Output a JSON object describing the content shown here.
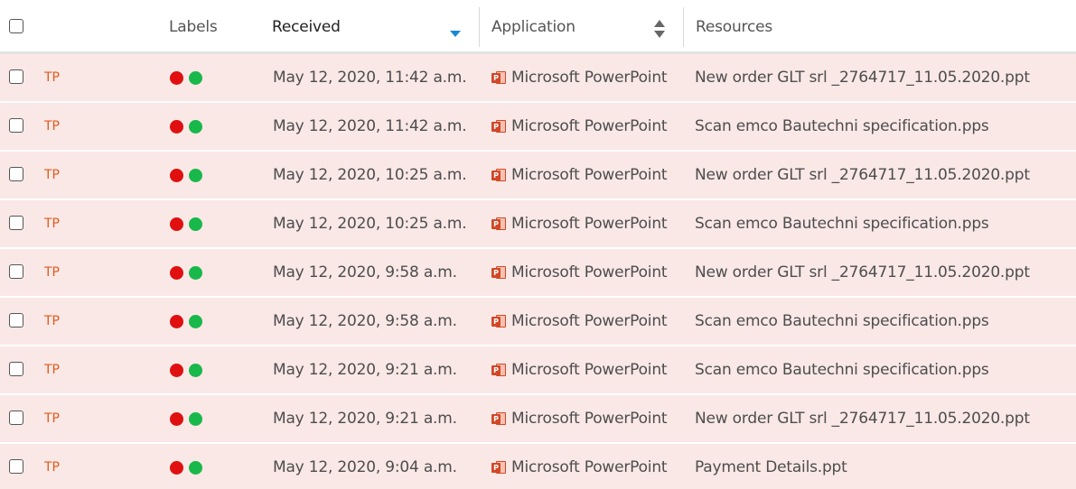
{
  "colors": {
    "row_background": "#fae8e6",
    "tp_label": "#e05a1e",
    "dot_red": "#e01010",
    "dot_green": "#19b84b",
    "sort_active": "#1a88d6",
    "powerpoint": "#d24726"
  },
  "header": {
    "labels": "Labels",
    "received": "Received",
    "application": "Application",
    "resources": "Resources",
    "sort_column": "Received",
    "sort_direction": "descending"
  },
  "rows": [
    {
      "tag": "TP",
      "received": "May 12, 2020, 11:42 a.m.",
      "application": "Microsoft PowerPoint",
      "app_icon": "powerpoint-icon",
      "resource": "New order GLT srl _2764717_11.05.2020.ppt"
    },
    {
      "tag": "TP",
      "received": "May 12, 2020, 11:42 a.m.",
      "application": "Microsoft PowerPoint",
      "app_icon": "powerpoint-icon",
      "resource": "Scan emco Bautechni specification.pps"
    },
    {
      "tag": "TP",
      "received": "May 12, 2020, 10:25 a.m.",
      "application": "Microsoft PowerPoint",
      "app_icon": "powerpoint-icon",
      "resource": "New order GLT srl _2764717_11.05.2020.ppt"
    },
    {
      "tag": "TP",
      "received": "May 12, 2020, 10:25 a.m.",
      "application": "Microsoft PowerPoint",
      "app_icon": "powerpoint-icon",
      "resource": "Scan emco Bautechni specification.pps"
    },
    {
      "tag": "TP",
      "received": "May 12, 2020, 9:58 a.m.",
      "application": "Microsoft PowerPoint",
      "app_icon": "powerpoint-icon",
      "resource": "New order GLT srl _2764717_11.05.2020.ppt"
    },
    {
      "tag": "TP",
      "received": "May 12, 2020, 9:58 a.m.",
      "application": "Microsoft PowerPoint",
      "app_icon": "powerpoint-icon",
      "resource": "Scan emco Bautechni specification.pps"
    },
    {
      "tag": "TP",
      "received": "May 12, 2020, 9:21 a.m.",
      "application": "Microsoft PowerPoint",
      "app_icon": "powerpoint-icon",
      "resource": "Scan emco Bautechni specification.pps"
    },
    {
      "tag": "TP",
      "received": "May 12, 2020, 9:21 a.m.",
      "application": "Microsoft PowerPoint",
      "app_icon": "powerpoint-icon",
      "resource": "New order GLT srl _2764717_11.05.2020.ppt"
    },
    {
      "tag": "TP",
      "received": "May 12, 2020, 9:04 a.m.",
      "application": "Microsoft PowerPoint",
      "app_icon": "powerpoint-icon",
      "resource": "Payment Details.ppt"
    }
  ]
}
